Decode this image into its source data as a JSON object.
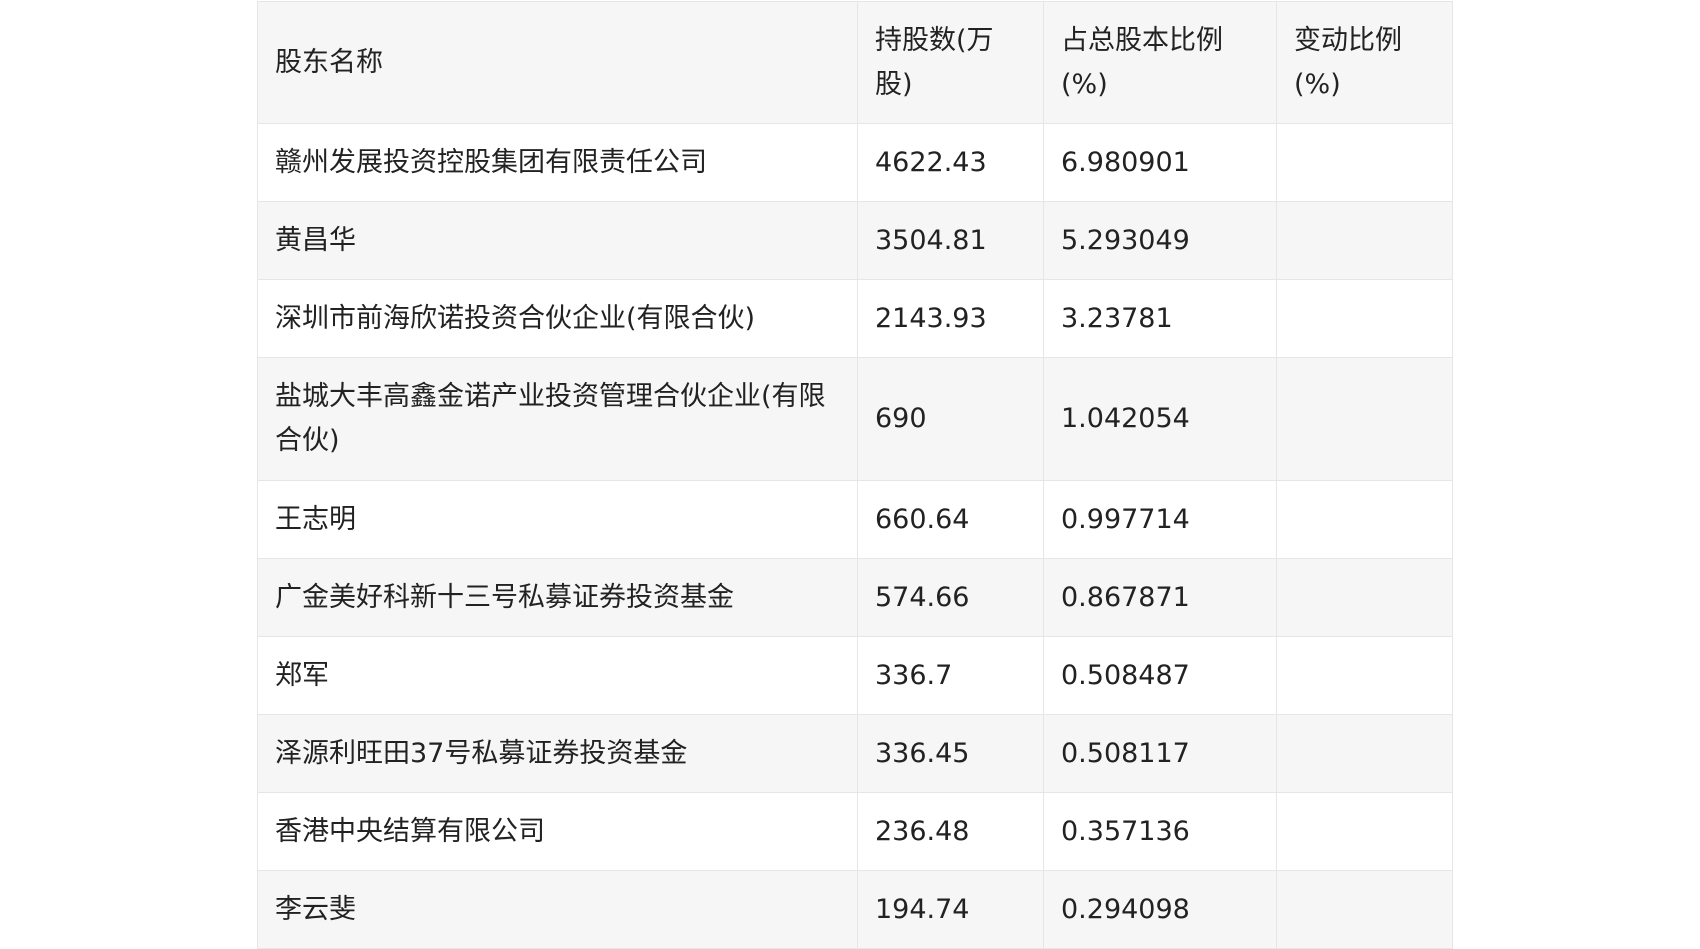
{
  "table": {
    "headers": [
      "股东名称",
      "持股数(万股)",
      "占总股本比例(%)",
      "变动比例(%)"
    ],
    "rows": [
      {
        "name": "赣州发展投资控股集团有限责任公司",
        "shares": "4622.43",
        "ratio": "6.980901",
        "change": ""
      },
      {
        "name": "黄昌华",
        "shares": "3504.81",
        "ratio": "5.293049",
        "change": ""
      },
      {
        "name": "深圳市前海欣诺投资合伙企业(有限合伙)",
        "shares": "2143.93",
        "ratio": "3.23781",
        "change": ""
      },
      {
        "name": "盐城大丰高鑫金诺产业投资管理合伙企业(有限合伙)",
        "shares": "690",
        "ratio": "1.042054",
        "change": ""
      },
      {
        "name": "王志明",
        "shares": "660.64",
        "ratio": "0.997714",
        "change": ""
      },
      {
        "name": "广金美好科新十三号私募证券投资基金",
        "shares": "574.66",
        "ratio": "0.867871",
        "change": ""
      },
      {
        "name": "郑军",
        "shares": "336.7",
        "ratio": "0.508487",
        "change": ""
      },
      {
        "name": "泽源利旺田37号私募证券投资基金",
        "shares": "336.45",
        "ratio": "0.508117",
        "change": ""
      },
      {
        "name": "香港中央结算有限公司",
        "shares": "236.48",
        "ratio": "0.357136",
        "change": ""
      },
      {
        "name": "李云斐",
        "shares": "194.74",
        "ratio": "0.294098",
        "change": ""
      }
    ]
  }
}
